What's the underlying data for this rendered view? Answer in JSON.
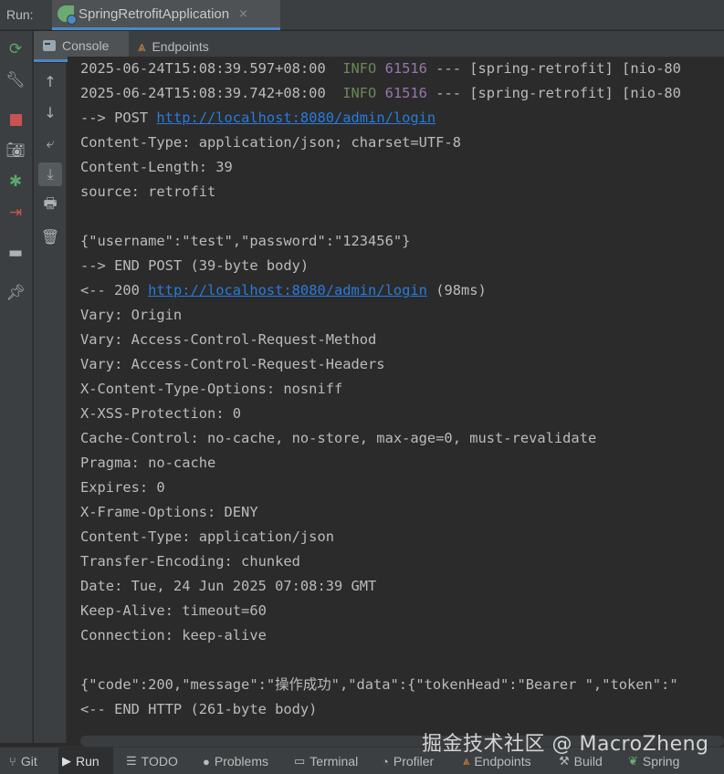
{
  "run_bar": {
    "label": "Run:",
    "tab_title": "SpringRetrofitApplication",
    "close_glyph": "×"
  },
  "console_tabs": [
    {
      "label": "Console",
      "icon": "console-icon"
    },
    {
      "label": "Endpoints",
      "icon": "endpoints-icon"
    }
  ],
  "log_lines": {
    "l1_ts": "2025-06-24T15:08:39.597+08:00  ",
    "l1_level": "INFO",
    "l1_pid": " 61516",
    "l1_rest": " --- [spring-retrofit] [nio-80",
    "l2_ts": "2025-06-24T15:08:39.742+08:00  ",
    "l2_level": "INFO",
    "l2_pid": " 61516",
    "l2_rest": " --- [spring-retrofit] [nio-80",
    "l3_prefix": "--> POST ",
    "l3_url": "http://localhost:8080/admin/login",
    "l4": "Content-Type: application/json; charset=UTF-8",
    "l5": "Content-Length: 39",
    "l6": "source: retrofit",
    "l7": "",
    "l8": "{\"username\":\"test\",\"password\":\"123456\"}",
    "l9": "--> END POST (39-byte body)",
    "l10_prefix": "<-- 200 ",
    "l10_url": "http://localhost:8080/admin/login",
    "l10_suffix": " (98ms)",
    "l11": "Vary: Origin",
    "l12": "Vary: Access-Control-Request-Method",
    "l13": "Vary: Access-Control-Request-Headers",
    "l14": "X-Content-Type-Options: nosniff",
    "l15": "X-XSS-Protection: 0",
    "l16": "Cache-Control: no-cache, no-store, max-age=0, must-revalidate",
    "l17": "Pragma: no-cache",
    "l18": "Expires: 0",
    "l19": "X-Frame-Options: DENY",
    "l20": "Content-Type: application/json",
    "l21": "Transfer-Encoding: chunked",
    "l22": "Date: Tue, 24 Jun 2025 07:08:39 GMT",
    "l23": "Keep-Alive: timeout=60",
    "l24": "Connection: keep-alive",
    "l25": "",
    "l26": "{\"code\":200,\"message\":\"操作成功\",\"data\":{\"tokenHead\":\"Bearer \",\"token\":\"",
    "l27": "<-- END HTTP (261-byte body)"
  },
  "bottom_tabs": [
    {
      "label": "Git",
      "icon": "git-branch-icon"
    },
    {
      "label": "Run",
      "icon": "run-icon"
    },
    {
      "label": "TODO",
      "icon": "todo-icon"
    },
    {
      "label": "Problems",
      "icon": "problems-icon"
    },
    {
      "label": "Terminal",
      "icon": "terminal-icon"
    },
    {
      "label": "Profiler",
      "icon": "profiler-icon"
    },
    {
      "label": "Endpoints",
      "icon": "endpoints-icon"
    },
    {
      "label": "Build",
      "icon": "build-icon"
    },
    {
      "label": "Spring",
      "icon": "spring-icon"
    }
  ],
  "watermark": "掘金技术社区 @ MacroZheng",
  "colors": {
    "accent": "#4a88c7",
    "link": "#287bde",
    "info": "#6a8759",
    "pid": "#9876aa",
    "background": "#2b2b2b"
  }
}
